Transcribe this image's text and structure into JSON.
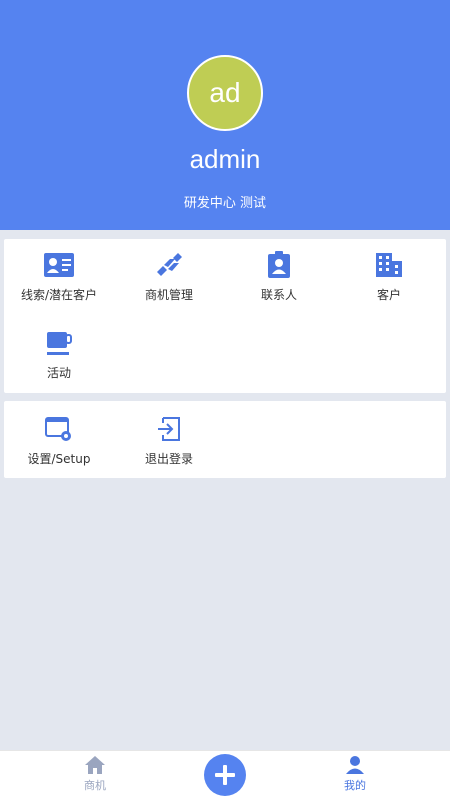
{
  "profile": {
    "avatar_text": "ad",
    "username": "admin",
    "department": "研发中心 测试",
    "avatar_color": "#bfcd54"
  },
  "header_color": "#5583f0",
  "modules": [
    {
      "label": "线索/潜在客户",
      "icon": "contact-card-icon"
    },
    {
      "label": "商机管理",
      "icon": "handshake-icon"
    },
    {
      "label": "联系人",
      "icon": "contact-badge-icon"
    },
    {
      "label": "客户",
      "icon": "building-icon"
    },
    {
      "label": "活动",
      "icon": "coffee-cup-icon"
    }
  ],
  "settings": [
    {
      "label": "设置/Setup",
      "icon": "settings-window-icon"
    },
    {
      "label": "退出登录",
      "icon": "logout-icon"
    }
  ],
  "tabbar": {
    "home_label": "商机",
    "mine_label": "我的",
    "add_icon": "plus-icon"
  }
}
